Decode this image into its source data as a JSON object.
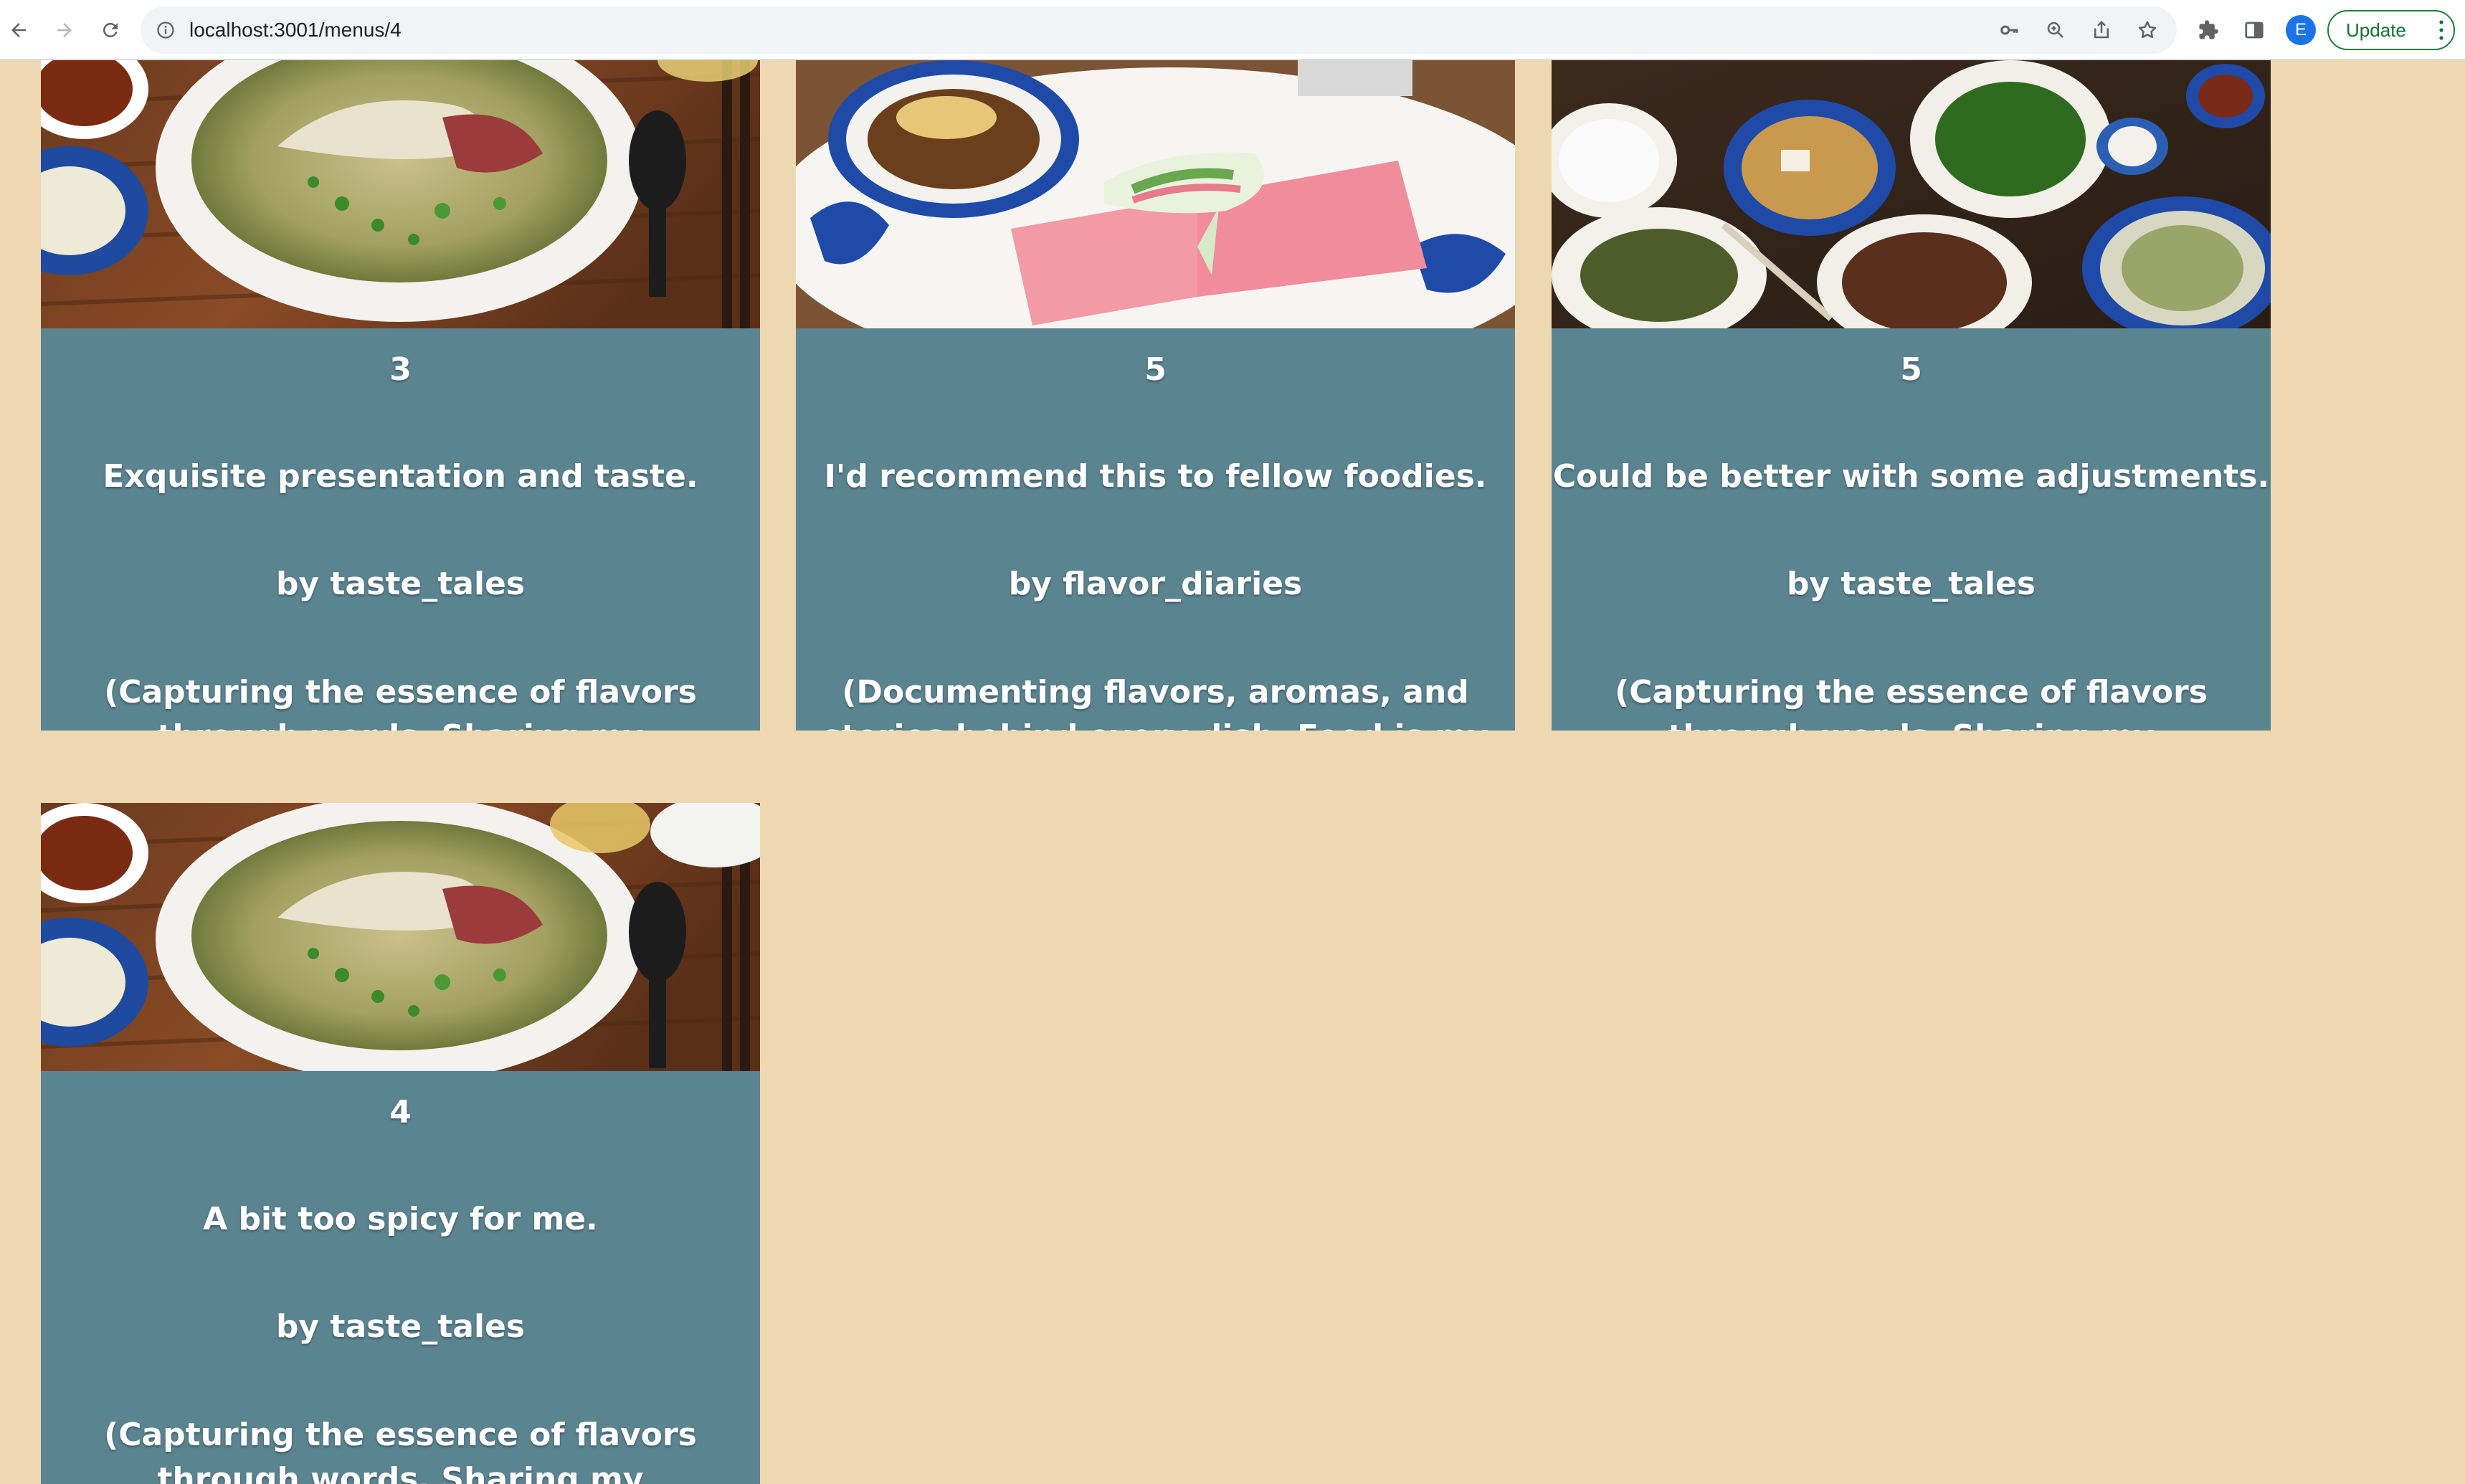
{
  "browser": {
    "url": "localhost:3001/menus/4",
    "profile_initial": "E",
    "update_label": "Update"
  },
  "reviews": [
    {
      "rating": "3",
      "comment": "Exquisite presentation and taste.",
      "author": "by taste_tales",
      "bio": "(Capturing the essence of flavors through words. Sharing my gastronomic journey",
      "image": "pho-bowl"
    },
    {
      "rating": "5",
      "comment": "I'd recommend this to fellow foodies.",
      "author": "by flavor_diaries",
      "bio": "(Documenting flavors, aromas, and stories behind every dish. Food is my language,",
      "image": "spring-rolls"
    },
    {
      "rating": "5",
      "comment": "Could be better with some adjustments.",
      "author": "by taste_tales",
      "bio": "(Capturing the essence of flavors through words. Sharing my gastronomic journey",
      "image": "vietnamese-feast"
    },
    {
      "rating": "4",
      "comment": "A bit too spicy for me.",
      "author": "by taste_tales",
      "bio": "(Capturing the essence of flavors through words. Sharing my gastronomic journey",
      "image": "pho-bowl"
    }
  ],
  "colors": {
    "page_background": "#eed8b2",
    "card_background": "#5b8491",
    "text": "#ffffff"
  }
}
